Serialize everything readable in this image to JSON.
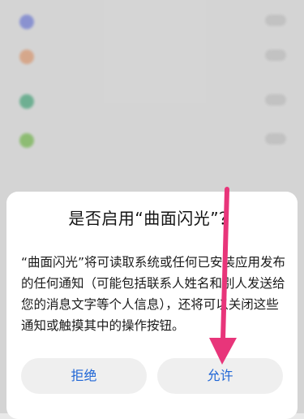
{
  "background_list": {
    "items": [
      {
        "icon": "app-icon",
        "color": "#6e7de6"
      },
      {
        "icon": "app-icon",
        "color": "#f0a070"
      },
      {
        "icon": "app-icon",
        "color": "#3fae7c"
      },
      {
        "icon": "app-icon",
        "color": "#74c447"
      }
    ]
  },
  "dialog": {
    "title": "是否启用“曲面闪光”？",
    "message": "“曲面闪光”将可读取系统或任何已安装应用发布的任何通知（可能包括联系人姓名和别人发送给您的消息文字等个人信息），还将可以关闭这些通知或触摸其中的操作按钮。",
    "deny_label": "拒绝",
    "allow_label": "允许"
  },
  "annotation": {
    "color": "#e8357a",
    "icon": "arrow-down-icon"
  }
}
